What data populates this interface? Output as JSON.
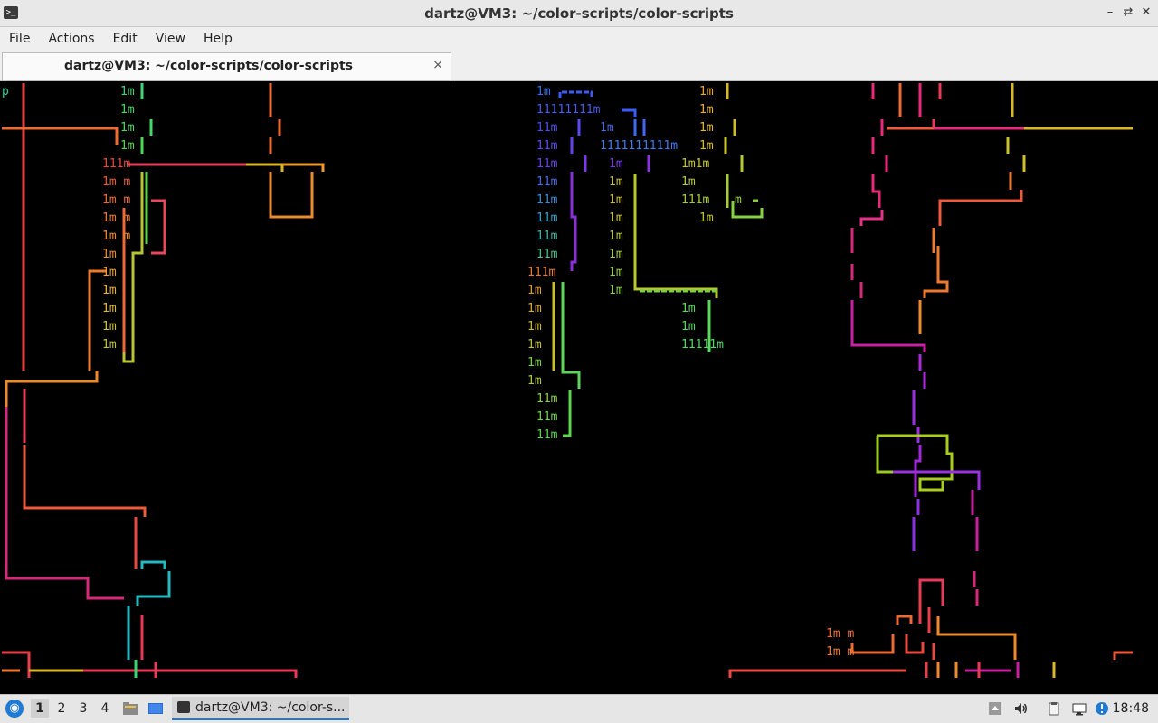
{
  "window": {
    "title": "dartz@VM3: ~/color-scripts/color-scripts"
  },
  "menu": [
    "File",
    "Actions",
    "Edit",
    "View",
    "Help"
  ],
  "tab": {
    "label": "dartz@VM3: ~/color-scripts/color-scripts",
    "close": "×"
  },
  "terminal": {
    "labels": [
      {
        "t": "p",
        "c": "#2bd4a0"
      },
      {
        "t": "1m",
        "c": "#3fd47a"
      },
      {
        "t": "1m",
        "c": "#44d86a"
      },
      {
        "t": "1m",
        "c": "#4cd65c"
      },
      {
        "t": "1m",
        "c": "#5ad34e"
      },
      {
        "t": "111m",
        "c": "#e8493f"
      },
      {
        "t": "1m m",
        "c": "#ea5a38"
      },
      {
        "t": "1m m",
        "c": "#ec6a34"
      },
      {
        "t": "1m m",
        "c": "#ec7a30"
      },
      {
        "t": "1m m",
        "c": "#ee8a2e"
      },
      {
        "t": "1m",
        "c": "#ee8e2c"
      },
      {
        "t": "1m",
        "c": "#eea02a"
      },
      {
        "t": "1m",
        "c": "#ecb02a"
      },
      {
        "t": "1m",
        "c": "#e0b82a"
      },
      {
        "t": "1m",
        "c": "#cfc02c"
      },
      {
        "t": "1m",
        "c": "#c0c430"
      },
      {
        "t": "1m",
        "c": "#3b6cf0"
      },
      {
        "t": "11111111m",
        "c": "#4a58f0"
      },
      {
        "t": "11m",
        "c": "#4c4ef0"
      },
      {
        "t": "1m",
        "c": "#4466f0"
      },
      {
        "t": "11m",
        "c": "#5a4cf0"
      },
      {
        "t": "1111111111m",
        "c": "#3f7cf0"
      },
      {
        "t": "11m",
        "c": "#6a42ec"
      },
      {
        "t": "1m",
        "c": "#7a3ae8"
      },
      {
        "t": "11m",
        "c": "#4a6ae8"
      },
      {
        "t": "11m",
        "c": "#3a8ad8"
      },
      {
        "t": "11m",
        "c": "#34a0c8"
      },
      {
        "t": "11m",
        "c": "#3cb4a8"
      },
      {
        "t": "11m",
        "c": "#44c488"
      },
      {
        "t": "111m",
        "c": "#e87a2e"
      },
      {
        "t": "1m",
        "c": "#dc9e2a"
      },
      {
        "t": "1m",
        "c": "#d8aa2a"
      },
      {
        "t": "1m",
        "c": "#cfb82c"
      },
      {
        "t": "1m",
        "c": "#c4c22e"
      },
      {
        "t": "1m",
        "c": "#b0c834"
      },
      {
        "t": "11m",
        "c": "#8cd040"
      },
      {
        "t": "11m",
        "c": "#6cd44c"
      },
      {
        "t": "11m",
        "c": "#5cd650"
      },
      {
        "t": "1m",
        "c": "#c4c02c"
      },
      {
        "t": "1m",
        "c": "#cdbd2c"
      },
      {
        "t": "1m",
        "c": "#c8c62e"
      },
      {
        "t": "1m",
        "c": "#b8c832"
      },
      {
        "t": "1m",
        "c": "#a8cc36"
      },
      {
        "t": "1m",
        "c": "#98d03a"
      },
      {
        "t": "1m",
        "c": "#88d23e"
      },
      {
        "t": "1m",
        "c": "#76d444"
      },
      {
        "t": "1m",
        "c": "#eaa82a"
      },
      {
        "t": "1m",
        "c": "#e6b22a"
      },
      {
        "t": "1m",
        "c": "#e0b82a"
      },
      {
        "t": "1m",
        "c": "#d8bc2a"
      },
      {
        "t": "1m1m",
        "c": "#c8c42e"
      },
      {
        "t": "111m",
        "c": "#a8cc34"
      },
      {
        "t": "m",
        "c": "#98d23a"
      },
      {
        "t": "1m",
        "c": "#b8c832"
      },
      {
        "t": "1m",
        "c": "#5cd65a"
      },
      {
        "t": "1m",
        "c": "#58d85e"
      },
      {
        "t": "1m",
        "c": "#52da62"
      },
      {
        "t": "11111m",
        "c": "#ec6a34"
      },
      {
        "t": "1m m",
        "c": "#ee7a30"
      },
      {
        "t": "1m m",
        "c": "#ea3a5a"
      }
    ]
  },
  "taskbar": {
    "workspaces": [
      "1",
      "2",
      "3",
      "4"
    ],
    "task_label": "dartz@VM3: ~/color-s...",
    "clock": "18:48"
  }
}
